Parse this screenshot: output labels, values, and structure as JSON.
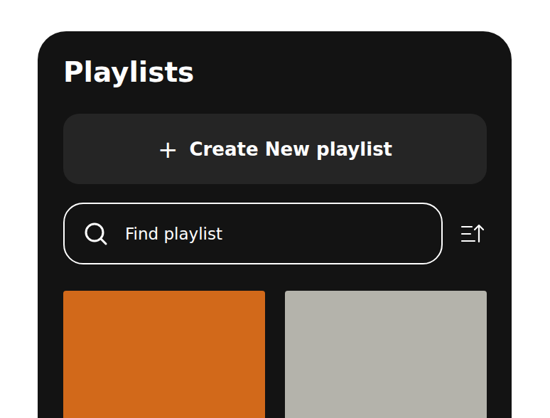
{
  "title": "Playlists",
  "create_button": {
    "icon": "+",
    "label": "Create New playlist"
  },
  "search": {
    "placeholder": "Find playlist"
  },
  "playlists": [
    {
      "color": "#d2691a"
    },
    {
      "color": "#b4b3ab"
    }
  ]
}
